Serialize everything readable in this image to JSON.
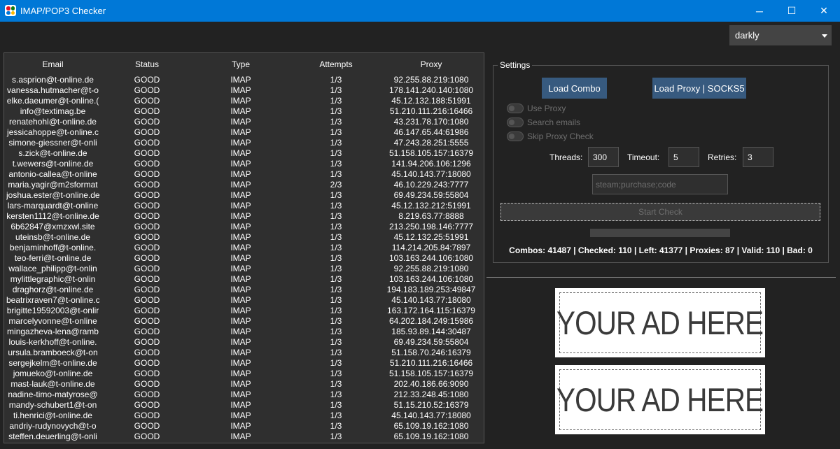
{
  "window": {
    "title": "IMAP/POP3 Checker",
    "minimize": "─",
    "maximize": "☐",
    "close": "✕",
    "icon_colors": [
      "#e81123",
      "#107c10",
      "#0078d7",
      "#ffb900"
    ]
  },
  "theme": {
    "selected": "darkly"
  },
  "table": {
    "columns": [
      "Email",
      "Status",
      "Type",
      "Attempts",
      "Proxy"
    ],
    "rows": [
      [
        "s.asprion@t-online.de",
        "GOOD",
        "IMAP",
        "1/3",
        "92.255.88.219:1080"
      ],
      [
        "vanessa.hutmacher@t-o",
        "GOOD",
        "IMAP",
        "1/3",
        "178.141.240.140:1080"
      ],
      [
        "elke.daeumer@t-online.(",
        "GOOD",
        "IMAP",
        "1/3",
        "45.12.132.188:51991"
      ],
      [
        "info@textimag.be",
        "GOOD",
        "IMAP",
        "1/3",
        "51.210.111.216:16466"
      ],
      [
        "renatehohl@t-online.de",
        "GOOD",
        "IMAP",
        "1/3",
        "43.231.78.170:1080"
      ],
      [
        "jessicahoppe@t-online.c",
        "GOOD",
        "IMAP",
        "1/3",
        "46.147.65.44:61986"
      ],
      [
        "simone-giessner@t-onli",
        "GOOD",
        "IMAP",
        "1/3",
        "47.243.28.251:5555"
      ],
      [
        "s.zick@t-online.de",
        "GOOD",
        "IMAP",
        "1/3",
        "51.158.105.157:16379"
      ],
      [
        "t.wewers@t-online.de",
        "GOOD",
        "IMAP",
        "1/3",
        "141.94.206.106:1296"
      ],
      [
        "antonio-callea@t-online",
        "GOOD",
        "IMAP",
        "1/3",
        "45.140.143.77:18080"
      ],
      [
        "maria.yagir@m2sformat",
        "GOOD",
        "IMAP",
        "2/3",
        "46.10.229.243:7777"
      ],
      [
        "joshua.ester@t-online.de",
        "GOOD",
        "IMAP",
        "1/3",
        "69.49.234.59:55804"
      ],
      [
        "lars-marquardt@t-online",
        "GOOD",
        "IMAP",
        "1/3",
        "45.12.132.212:51991"
      ],
      [
        "kersten1112@t-online.de",
        "GOOD",
        "IMAP",
        "1/3",
        "8.219.63.77:8888"
      ],
      [
        "6b62847@xmzxwl.site",
        "GOOD",
        "IMAP",
        "1/3",
        "213.250.198.146:7777"
      ],
      [
        "uteinsb@t-online.de",
        "GOOD",
        "IMAP",
        "1/3",
        "45.12.132.25:51991"
      ],
      [
        "benjaminhoff@t-online.",
        "GOOD",
        "IMAP",
        "1/3",
        "114.214.205.84:7897"
      ],
      [
        "teo-ferri@t-online.de",
        "GOOD",
        "IMAP",
        "1/3",
        "103.163.244.106:1080"
      ],
      [
        "wallace_philipp@t-onlin",
        "GOOD",
        "IMAP",
        "1/3",
        "92.255.88.219:1080"
      ],
      [
        "mylittlegraphic@t-onlin",
        "GOOD",
        "IMAP",
        "1/3",
        "103.163.244.106:1080"
      ],
      [
        "draghorz@t-online.de",
        "GOOD",
        "IMAP",
        "1/3",
        "194.183.189.253:49847"
      ],
      [
        "beatrixraven7@t-online.c",
        "GOOD",
        "IMAP",
        "1/3",
        "45.140.143.77:18080"
      ],
      [
        "brigitte19592003@t-onlir",
        "GOOD",
        "IMAP",
        "1/3",
        "163.172.164.115:16379"
      ],
      [
        "marcelyvonne@t-online",
        "GOOD",
        "IMAP",
        "1/3",
        "64.202.184.249:15986"
      ],
      [
        "mingazheva-lena@ramb",
        "GOOD",
        "IMAP",
        "1/3",
        "185.93.89.144:30487"
      ],
      [
        "louis-kerkhoff@t-online.",
        "GOOD",
        "IMAP",
        "1/3",
        "69.49.234.59:55804"
      ],
      [
        "ursula.bramboeck@t-on",
        "GOOD",
        "IMAP",
        "1/3",
        "51.158.70.246:16379"
      ],
      [
        "sergejkelm@t-online.de",
        "GOOD",
        "IMAP",
        "1/3",
        "51.210.111.216:16466"
      ],
      [
        "jomueko@t-online.de",
        "GOOD",
        "IMAP",
        "1/3",
        "51.158.105.157:16379"
      ],
      [
        "mast-lauk@t-online.de",
        "GOOD",
        "IMAP",
        "1/3",
        "202.40.186.66:9090"
      ],
      [
        "nadine-timo-matyrose@",
        "GOOD",
        "IMAP",
        "1/3",
        "212.33.248.45:1080"
      ],
      [
        "mandy-schubert1@t-on",
        "GOOD",
        "IMAP",
        "1/3",
        "51.15.210.52:16379"
      ],
      [
        "ti.henrici@t-online.de",
        "GOOD",
        "IMAP",
        "1/3",
        "45.140.143.77:18080"
      ],
      [
        "andriy-rudynovych@t-o",
        "GOOD",
        "IMAP",
        "1/3",
        "65.109.19.162:1080"
      ],
      [
        "steffen.deuerling@t-onli",
        "GOOD",
        "IMAP",
        "1/3",
        "65.109.19.162:1080"
      ]
    ]
  },
  "settings": {
    "title": "Settings",
    "load_combo": "Load Combo",
    "load_proxy": "Load Proxy | SOCKS5",
    "toggles": [
      "Use Proxy",
      "Search emails",
      "Skip Proxy Check"
    ],
    "threads_label": "Threads:",
    "threads_value": "300",
    "timeout_label": "Timeout:",
    "timeout_value": "5",
    "retries_label": "Retries:",
    "retries_value": "3",
    "keywords": "steam;purchase;code",
    "start_label": "Start Check",
    "progress": 0,
    "stats": "Combos: 41487 | Checked: 110 | Left: 41377 | Proxies: 87 | Valid: 110 | Bad: 0"
  },
  "ads": [
    "YOUR AD HERE",
    "YOUR AD HERE"
  ],
  "colors": {
    "titlebar": "#0078d7",
    "background": "#222222",
    "primary_button": "#375a7f"
  }
}
